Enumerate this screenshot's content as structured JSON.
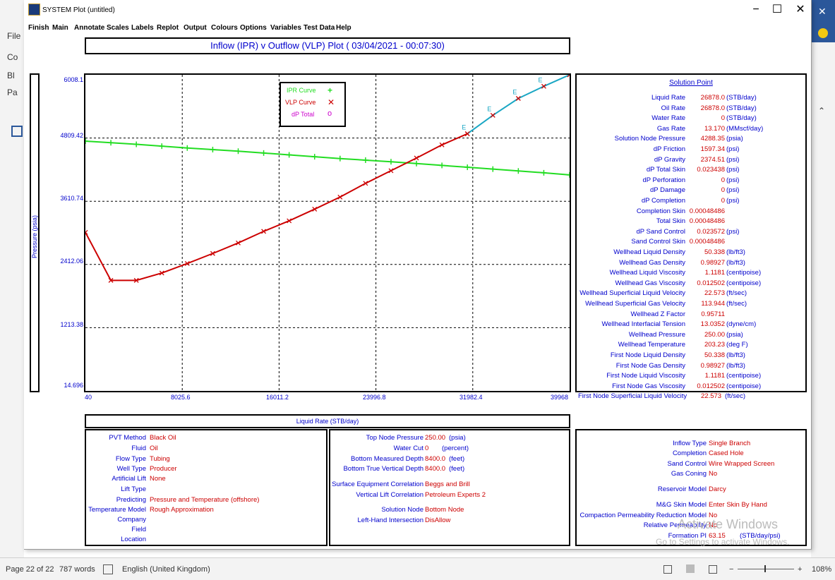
{
  "app": {
    "title": "SYSTEM Plot (untitled)"
  },
  "word": {
    "left_labels": [
      "File",
      "Co",
      "Bl",
      "Pa"
    ],
    "status": {
      "page": "Page 22 of 22",
      "words": "787 words",
      "language": "English (United Kingdom)",
      "zoom": "108%"
    }
  },
  "menu": [
    "Finish",
    "Main",
    "Annotate",
    "Scales",
    "Labels",
    "Replot",
    "Output",
    "Colours",
    "Options",
    "Variables",
    "Test Data",
    "Help"
  ],
  "plot_title": "Inflow (IPR) v Outflow (VLP) Plot ( 03/04/2021 - 00:07:30)",
  "colors": {
    "ipr": "#22dd22",
    "vlp": "#cc0000",
    "dp": "#cc00cc",
    "label_blue": "#0000cc",
    "value_red": "#cc0000",
    "tail": "#1aa7c4"
  },
  "chart_data": {
    "type": "line",
    "xlabel": "Liquid Rate  (STB/day)",
    "ylabel": "Pressure  (psia)",
    "xlim": [
      40,
      39968
    ],
    "ylim": [
      14.696,
      6008.1
    ],
    "xticks": [
      "40",
      "8025.6",
      "16011.2",
      "23996.8",
      "31982.4",
      "39968"
    ],
    "yticks": [
      "6008.1",
      "4809.42",
      "3610.74",
      "2412.06",
      "1213.38",
      "14.696"
    ],
    "grid": true,
    "legend": [
      "IPR Curve",
      "VLP Curve",
      "dP Total"
    ],
    "legend_position": "top-center",
    "series": [
      {
        "name": "IPR Curve",
        "x": [
          40,
          2140,
          4240,
          6340,
          8440,
          10540,
          12640,
          14740,
          16840,
          18940,
          21040,
          23140,
          25240,
          27340,
          29440,
          31540,
          33640,
          35740,
          37840,
          39968
        ],
        "y": [
          4750,
          4720,
          4690,
          4655,
          4620,
          4590,
          4560,
          4525,
          4490,
          4455,
          4420,
          4390,
          4360,
          4325,
          4290,
          4255,
          4220,
          4185,
          4150,
          4110
        ]
      },
      {
        "name": "VLP Curve",
        "x": [
          40,
          2140,
          4240,
          6340,
          8440,
          10540,
          12640,
          14740,
          16840,
          18940,
          21040,
          23140,
          25240,
          27340,
          29440,
          31540
        ],
        "y": [
          3020,
          2110,
          2110,
          2250,
          2430,
          2620,
          2820,
          3040,
          3240,
          3460,
          3690,
          3950,
          4190,
          4430,
          4680,
          4890
        ]
      },
      {
        "name": "VLP extension",
        "x": [
          31540,
          33640,
          35740,
          37840,
          39968
        ],
        "y": [
          4890,
          5240,
          5560,
          5790,
          6008.1
        ]
      }
    ],
    "point_labels": [
      "E",
      "E",
      "E",
      "E",
      "E"
    ]
  },
  "solution": {
    "heading": "Solution Point",
    "rows": [
      {
        "label": "Liquid Rate",
        "value": "26878.0",
        "unit": "(STB/day)"
      },
      {
        "label": "Oil Rate",
        "value": "26878.0",
        "unit": "(STB/day)"
      },
      {
        "label": "Water Rate",
        "value": "0",
        "unit": "(STB/day)"
      },
      {
        "label": "Gas Rate",
        "value": "13.170",
        "unit": "(MMscf/day)"
      },
      {
        "label": "Solution Node Pressure",
        "value": "4288.35",
        "unit": "(psia)"
      },
      {
        "label": "dP Friction",
        "value": "1597.34",
        "unit": "(psi)"
      },
      {
        "label": "dP Gravity",
        "value": "2374.51",
        "unit": "(psi)"
      },
      {
        "label": "dP Total Skin",
        "value": "0.023438",
        "unit": "(psi)"
      },
      {
        "label": "dP Perforation",
        "value": "0",
        "unit": "(psi)"
      },
      {
        "label": "dP Damage",
        "value": "0",
        "unit": "(psi)"
      },
      {
        "label": "dP Completion",
        "value": "0",
        "unit": "(psi)"
      },
      {
        "label": "Completion Skin",
        "value": "0.00048486",
        "unit": ""
      },
      {
        "label": "Total Skin",
        "value": "0.00048486",
        "unit": ""
      },
      {
        "label": "dP Sand Control",
        "value": "0.023572",
        "unit": "(psi)"
      },
      {
        "label": "Sand Control Skin",
        "value": "0.00048486",
        "unit": ""
      },
      {
        "label": "Wellhead Liquid Density",
        "value": "50.338",
        "unit": "(lb/ft3)"
      },
      {
        "label": "Wellhead Gas Density",
        "value": "0.98927",
        "unit": "(lb/ft3)"
      },
      {
        "label": "Wellhead Liquid Viscosity",
        "value": "1.1181",
        "unit": "(centipoise)"
      },
      {
        "label": "Wellhead Gas Viscosity",
        "value": "0.012502",
        "unit": "(centipoise)"
      },
      {
        "label": "Wellhead Superficial Liquid Velocity",
        "value": "22.573",
        "unit": "(ft/sec)"
      },
      {
        "label": "Wellhead Superficial Gas Velocity",
        "value": "113.944",
        "unit": "(ft/sec)"
      },
      {
        "label": "Wellhead Z Factor",
        "value": "0.95711",
        "unit": ""
      },
      {
        "label": "Wellhead Interfacial Tension",
        "value": "13.0352",
        "unit": "(dyne/cm)"
      },
      {
        "label": "Wellhead Pressure",
        "value": "250.00",
        "unit": "(psia)"
      },
      {
        "label": "Wellhead Temperature",
        "value": "203.23",
        "unit": "(deg F)"
      },
      {
        "label": "First Node Liquid Density",
        "value": "50.338",
        "unit": "(lb/ft3)"
      },
      {
        "label": "First Node Gas Density",
        "value": "0.98927",
        "unit": "(lb/ft3)"
      },
      {
        "label": "First Node Liquid Viscosity",
        "value": "1.1181",
        "unit": "(centipoise)"
      },
      {
        "label": "First Node Gas Viscosity",
        "value": "0.012502",
        "unit": "(centipoise)"
      }
    ],
    "extra": {
      "label": "First Node Superficial Liquid Velocity",
      "value": "22.573",
      "unit": "(ft/sec)"
    }
  },
  "panel1": [
    {
      "label": "PVT Method",
      "value": "Black Oil"
    },
    {
      "label": "Fluid",
      "value": "Oil"
    },
    {
      "label": "Flow Type",
      "value": "Tubing"
    },
    {
      "label": "Well Type",
      "value": "Producer"
    },
    {
      "label": "Artificial Lift",
      "value": "None"
    },
    {
      "label": "Lift Type",
      "value": ""
    },
    {
      "label": "Predicting",
      "value": "Pressure and Temperature (offshore)"
    },
    {
      "label": "Temperature Model",
      "value": "Rough Approximation"
    },
    {
      "label": "Company",
      "value": ""
    },
    {
      "label": "Field",
      "value": ""
    },
    {
      "label": "Location",
      "value": ""
    },
    {
      "label": "Well",
      "value": ""
    }
  ],
  "panel2": [
    {
      "label": "Top Node Pressure",
      "value": "250.00",
      "unit": "(psia)"
    },
    {
      "label": "Water Cut",
      "value": "0",
      "unit": "(percent)"
    },
    {
      "label": "Bottom Measured Depth",
      "value": "8400.0",
      "unit": "(feet)"
    },
    {
      "label": "Bottom True Vertical Depth",
      "value": "8400.0",
      "unit": "(feet)"
    },
    {
      "label": "Surface Equipment Correlation",
      "value": "Beggs and Brill",
      "unit": ""
    },
    {
      "label": "Vertical Lift Correlation",
      "value": "Petroleum Experts 2",
      "unit": ""
    },
    {
      "label": "Solution Node",
      "value": "Bottom Node",
      "unit": ""
    },
    {
      "label": "Left-Hand Intersection",
      "value": "DisAllow",
      "unit": ""
    }
  ],
  "panel3": [
    {
      "label": "Inflow Type",
      "value": "Single Branch",
      "unit": ""
    },
    {
      "label": "Completion",
      "value": "Cased Hole",
      "unit": ""
    },
    {
      "label": "Sand Control",
      "value": "Wire Wrapped Screen",
      "unit": ""
    },
    {
      "label": "Gas Coning",
      "value": "No",
      "unit": ""
    },
    {
      "label": "Reservoir Model",
      "value": "Darcy",
      "unit": ""
    },
    {
      "label": "M&G Skin Model",
      "value": "Enter Skin By Hand",
      "unit": ""
    },
    {
      "label": "Compaction Permeability Reduction Model",
      "value": "No",
      "unit": ""
    },
    {
      "label": "Relative Permeability",
      "value": "No",
      "unit": ""
    },
    {
      "label": "Formation PI",
      "value": "63.15",
      "unit": "(STB/day/psi)"
    }
  ],
  "watermark": {
    "line1": "Activate Windows",
    "line2": "Go to Settings to activate Windows."
  }
}
